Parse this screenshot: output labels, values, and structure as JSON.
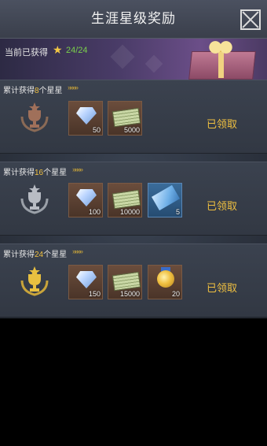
{
  "header": {
    "title": "生涯星级奖励"
  },
  "progress": {
    "label": "当前已获得",
    "value": "24/24"
  },
  "tiers": [
    {
      "prefix": "累计获得",
      "stars": "8",
      "suffix": "个星星",
      "trophy": "bronze",
      "rewards": [
        {
          "icon": "diamond-icon",
          "qty": "50"
        },
        {
          "icon": "cash-icon",
          "qty": "5000"
        }
      ],
      "status": "已领取"
    },
    {
      "prefix": "累计获得",
      "stars": "16",
      "suffix": "个星星",
      "trophy": "silver",
      "rewards": [
        {
          "icon": "diamond-icon",
          "qty": "100"
        },
        {
          "icon": "cash-icon",
          "qty": "10000"
        },
        {
          "icon": "ticket-icon",
          "qty": "5"
        }
      ],
      "status": "已领取"
    },
    {
      "prefix": "累计获得",
      "stars": "24",
      "suffix": "个星星",
      "trophy": "gold",
      "rewards": [
        {
          "icon": "diamond-icon",
          "qty": "150"
        },
        {
          "icon": "cash-icon",
          "qty": "15000"
        },
        {
          "icon": "medal-icon",
          "qty": "20"
        }
      ],
      "status": "已领取"
    }
  ],
  "colors": {
    "accent": "#f0c040",
    "progress": "#7ad04b",
    "bronze": "#a0705a",
    "silver": "#b8bcc4",
    "gold": "#e8c040"
  }
}
